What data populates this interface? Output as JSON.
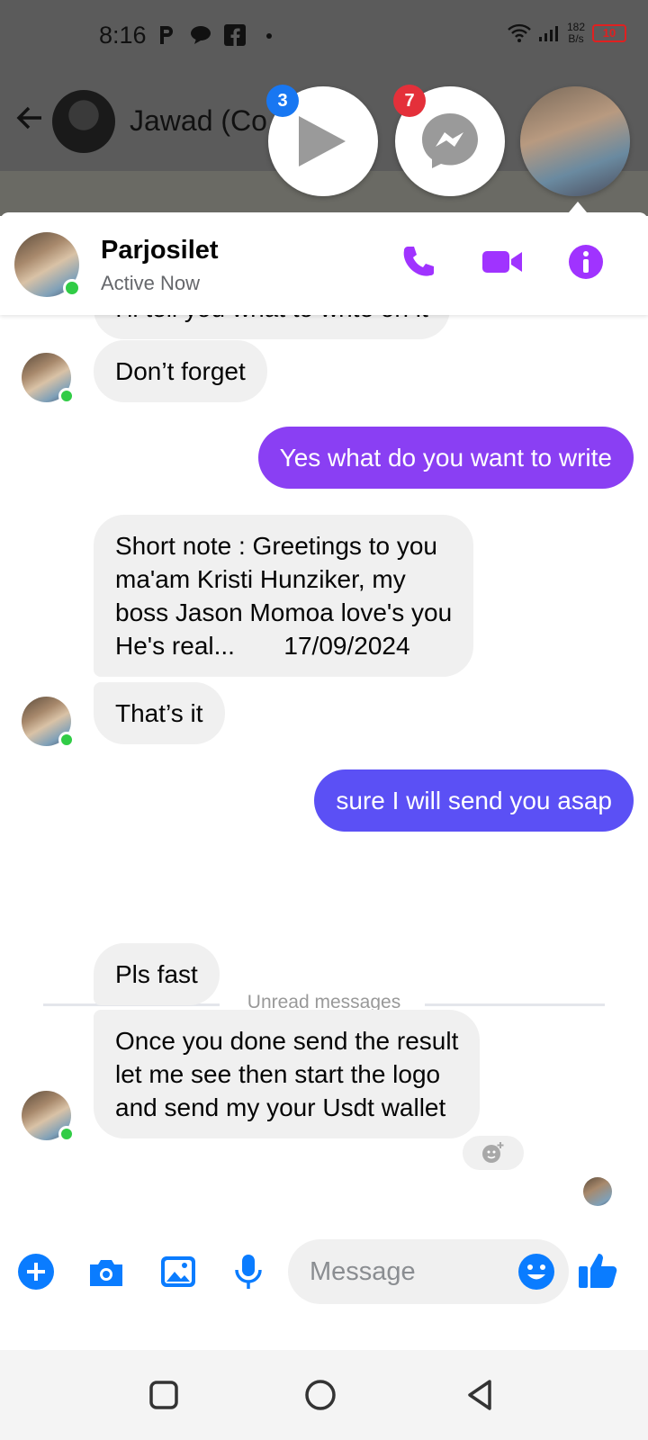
{
  "status_bar": {
    "time": "8:16",
    "net_speed_value": "182",
    "net_speed_unit": "B/s",
    "battery": "10"
  },
  "underlying_chat": {
    "name": "Jawad (Co"
  },
  "chat_heads": [
    {
      "icon": "play-icon",
      "badge": "3"
    },
    {
      "icon": "messenger-icon",
      "badge": "7"
    },
    {
      "icon": "contact-avatar"
    }
  ],
  "header": {
    "name": "Parjosilet",
    "status": "Active Now"
  },
  "messages": [
    {
      "side": "in",
      "text": "I'll tell you what to write on it",
      "partial": true
    },
    {
      "side": "in",
      "text": "Don’t forget"
    },
    {
      "side": "out",
      "text": "Yes what do you want to write",
      "color": "#8a3ff3"
    },
    {
      "side": "in",
      "lines": [
        "Short note : Greetings to you",
        "ma'am Kristi Hunziker, my",
        "boss Jason Momoa love's you",
        "He's real...       17/09/2024"
      ]
    },
    {
      "side": "in",
      "text": "That’s it"
    },
    {
      "side": "out",
      "text": "sure I will send you asap",
      "color": "#5b50f5"
    },
    {
      "side": "in",
      "text": "Pls fast"
    },
    {
      "side": "in",
      "lines": [
        "Once you done send the result",
        "let me see then start the logo",
        "and send my your Usdt wallet"
      ]
    }
  ],
  "divider": {
    "label": "Unread messages"
  },
  "composer": {
    "placeholder": "Message"
  },
  "colors": {
    "accent": "#a033ff",
    "composer_blue": "#0a7cff",
    "online": "#31cc46"
  }
}
